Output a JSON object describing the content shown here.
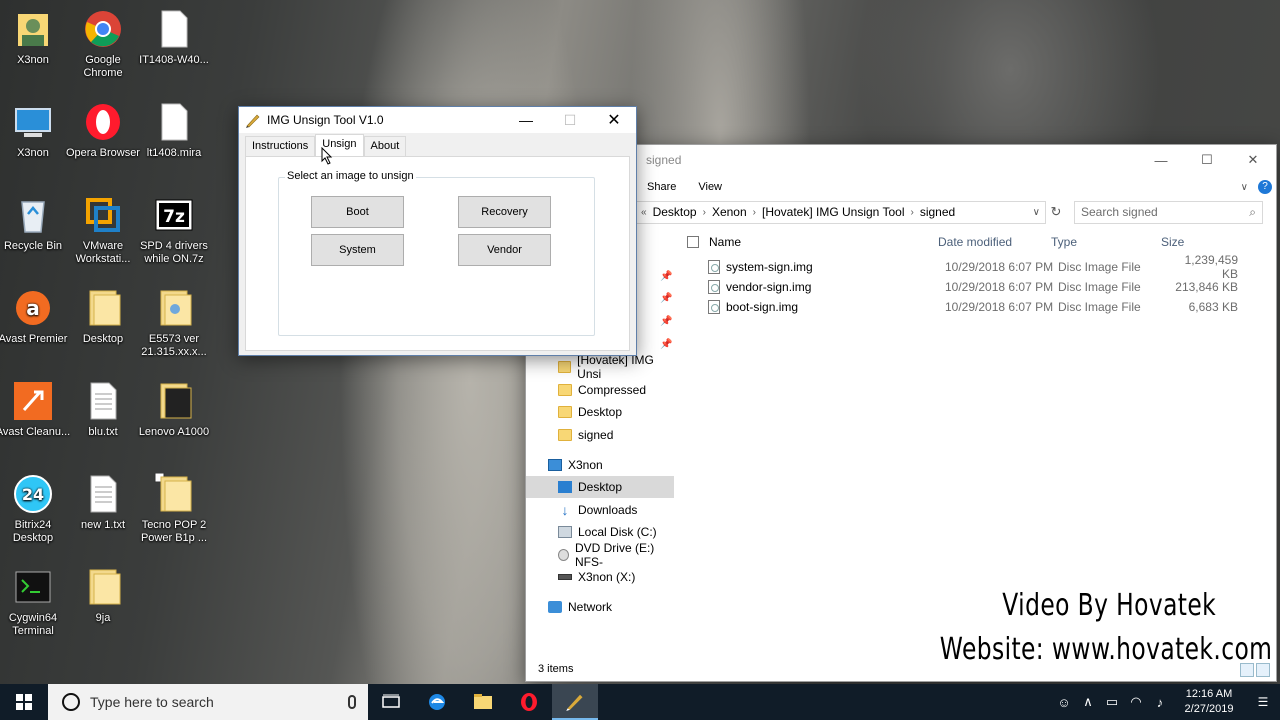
{
  "desktop": {
    "icons": [
      {
        "label": "X3non",
        "icon": "user-folder-icon"
      },
      {
        "label": "Google Chrome",
        "icon": "chrome-icon"
      },
      {
        "label": "IT1408-W40...",
        "icon": "file-icon"
      },
      {
        "label": "X3non",
        "icon": "this-pc-icon"
      },
      {
        "label": "Opera Browser",
        "icon": "opera-icon"
      },
      {
        "label": "lt1408.mira",
        "icon": "file-icon"
      },
      {
        "label": "Recycle Bin",
        "icon": "recycle-bin-icon"
      },
      {
        "label": "VMware Workstati...",
        "icon": "vmware-icon"
      },
      {
        "label": "SPD 4 drivers while ON.7z",
        "icon": "7zip-icon"
      },
      {
        "label": "Avast Premier",
        "icon": "avast-icon"
      },
      {
        "label": "Desktop",
        "icon": "folder-icon"
      },
      {
        "label": "E5573 ver 21.315.xx.x...",
        "icon": "folder-icon"
      },
      {
        "label": "Avast Cleanu...",
        "icon": "avast-cleanup-icon"
      },
      {
        "label": "blu.txt",
        "icon": "text-file-icon"
      },
      {
        "label": "Lenovo A1000",
        "icon": "folder-icon"
      },
      {
        "label": "Bitrix24 Desktop",
        "icon": "bitrix24-icon"
      },
      {
        "label": "new 1.txt",
        "icon": "text-file-icon"
      },
      {
        "label": "Tecno POP 2 Power B1p ...",
        "icon": "folder-icon"
      },
      {
        "label": "Cygwin64 Terminal",
        "icon": "terminal-icon"
      },
      {
        "label": "9ja",
        "icon": "folder-icon"
      }
    ]
  },
  "tool": {
    "title": "IMG Unsign Tool V1.0",
    "tabs": [
      "Instructions",
      "Unsign",
      "About"
    ],
    "active_tab": "Unsign",
    "group_label": "Select an image to unsign",
    "buttons": {
      "boot": "Boot",
      "recovery": "Recovery",
      "system": "System",
      "vendor": "Vendor"
    }
  },
  "explorer": {
    "title": "signed",
    "ribbon": [
      "Share",
      "View"
    ],
    "breadcrumb": [
      "Desktop",
      "Xenon",
      "[Hovatek] IMG Unsign Tool",
      "signed"
    ],
    "search_placeholder": "Search signed",
    "columns": {
      "name": "Name",
      "date": "Date modified",
      "type": "Type",
      "size": "Size"
    },
    "files": [
      {
        "name": "system-sign.img",
        "date": "10/29/2018 6:07 PM",
        "type": "Disc Image File",
        "size": "1,239,459 KB"
      },
      {
        "name": "vendor-sign.img",
        "date": "10/29/2018 6:07 PM",
        "type": "Disc Image File",
        "size": "213,846 KB"
      },
      {
        "name": "boot-sign.img",
        "date": "10/29/2018 6:07 PM",
        "type": "Disc Image File",
        "size": "6,683 KB"
      }
    ],
    "nav": [
      {
        "label": "[Hovatek] IMG Unsi",
        "icon": "folder-icon"
      },
      {
        "label": "Compressed",
        "icon": "folder-icon"
      },
      {
        "label": "Desktop",
        "icon": "folder-icon"
      },
      {
        "label": "signed",
        "icon": "folder-icon"
      },
      {
        "label": "X3non",
        "icon": "this-pc-icon"
      },
      {
        "label": "Desktop",
        "icon": "desktop-icon"
      },
      {
        "label": "Downloads",
        "icon": "download-icon"
      },
      {
        "label": "Local Disk (C:)",
        "icon": "drive-icon"
      },
      {
        "label": "DVD Drive (E:) NFS-",
        "icon": "dvd-icon"
      },
      {
        "label": "X3non (X:)",
        "icon": "drive-icon"
      },
      {
        "label": "Network",
        "icon": "network-icon"
      }
    ],
    "selected_nav": "Desktop",
    "status": "3 items"
  },
  "watermark": {
    "line1": "Video By Hovatek",
    "line2": "Website: www.hovatek.com"
  },
  "taskbar": {
    "search_placeholder": "Type here to search",
    "time": "12:16 AM",
    "date": "2/27/2019"
  }
}
